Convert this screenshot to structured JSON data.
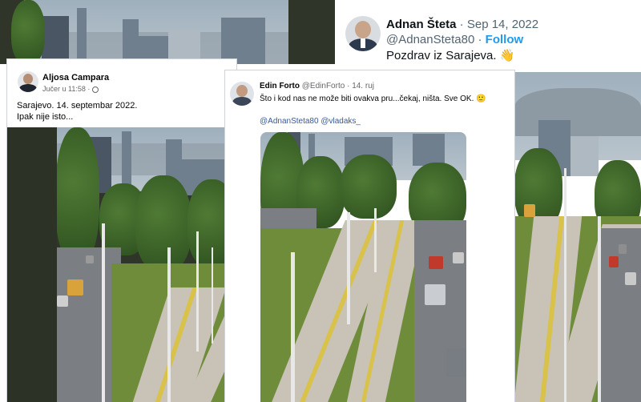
{
  "twitter_post": {
    "name": "Adnan Šteta",
    "separator": " · ",
    "date": "Sep 14, 2022",
    "handle": "@AdnanSteta80",
    "follow_separator": " · ",
    "follow_label": "Follow",
    "text": "Pozdrav iz Sarajeva.",
    "emoji": "👋",
    "emoji_name": "waving-hand"
  },
  "fb_post_left": {
    "name": "Aljosa Campara",
    "time": "Jučer u 11:58 · ",
    "privacy_icon": "globe-icon",
    "line1": "Sarajevo. 14. septembar 2022.",
    "line2": "Ipak nije isto..."
  },
  "fb_post_middle": {
    "name": "Edin Forto",
    "handle": "@EdinForto",
    "separator": " · ",
    "date": "14. ruj",
    "text": "Što i kod nas ne može biti ovakva pru...čekaj, ništa. Sve OK.",
    "emoji": "🙂",
    "emoji_name": "slightly-smiling-face",
    "mentions": [
      "@AdnanSteta80",
      "@vladaks_"
    ]
  },
  "colors": {
    "twitter_blue": "#1d9bf0",
    "fb_link": "#385898",
    "text_dark": "#050505",
    "meta_grey": "#65676b"
  }
}
